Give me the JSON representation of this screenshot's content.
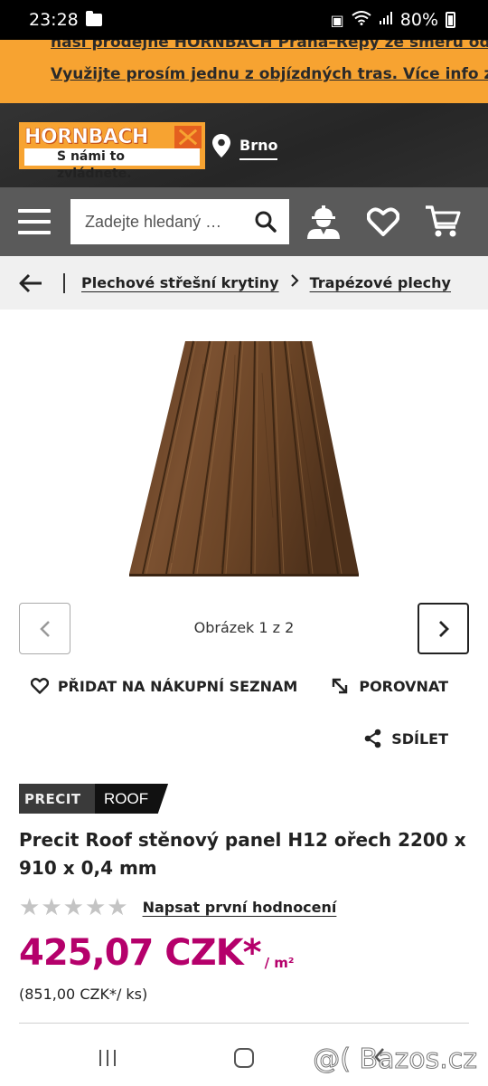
{
  "status_bar": {
    "time": "23:28",
    "battery": "80%"
  },
  "banner": {
    "line1": "naší prodejně HORNBACH Praha–Řepy ze směru od centra.",
    "line2": "Využijte prosím jednu z objízdných tras. Více info zde."
  },
  "header": {
    "logo_name": "HORNBACH",
    "logo_slogan": "S námi to zvládnete.",
    "location": "Brno"
  },
  "search": {
    "placeholder": "Zadejte hledaný …"
  },
  "breadcrumb": {
    "items": [
      "Plechové střešní krytiny",
      "Trapézové plechy"
    ]
  },
  "gallery": {
    "counter": "Obrázek 1 z 2"
  },
  "actions": {
    "add_to_list": "PŘIDAT NA NÁKUPNÍ SEZNAM",
    "compare": "POROVNAT",
    "share": "SDÍLET"
  },
  "product": {
    "brand_left": "PRECIT",
    "brand_right": "ROOF",
    "title": "Precit Roof stěnový panel H12 ořech 2200 x 910 x 0,4 mm",
    "rating_stars": 0,
    "rating_max": 5,
    "rating_link": "Napsat první hodnocení",
    "price": "425,07 CZK*",
    "price_unit": "/ m²",
    "price_per_piece": "(851,00 CZK*/ ks)"
  },
  "colors": {
    "banner": "#f7a331",
    "header": "#2b2b2b",
    "navbar": "#5a5a5a",
    "price": "#b5006b",
    "wood": "#6b4426"
  },
  "watermark": "@( Bazos.cz"
}
